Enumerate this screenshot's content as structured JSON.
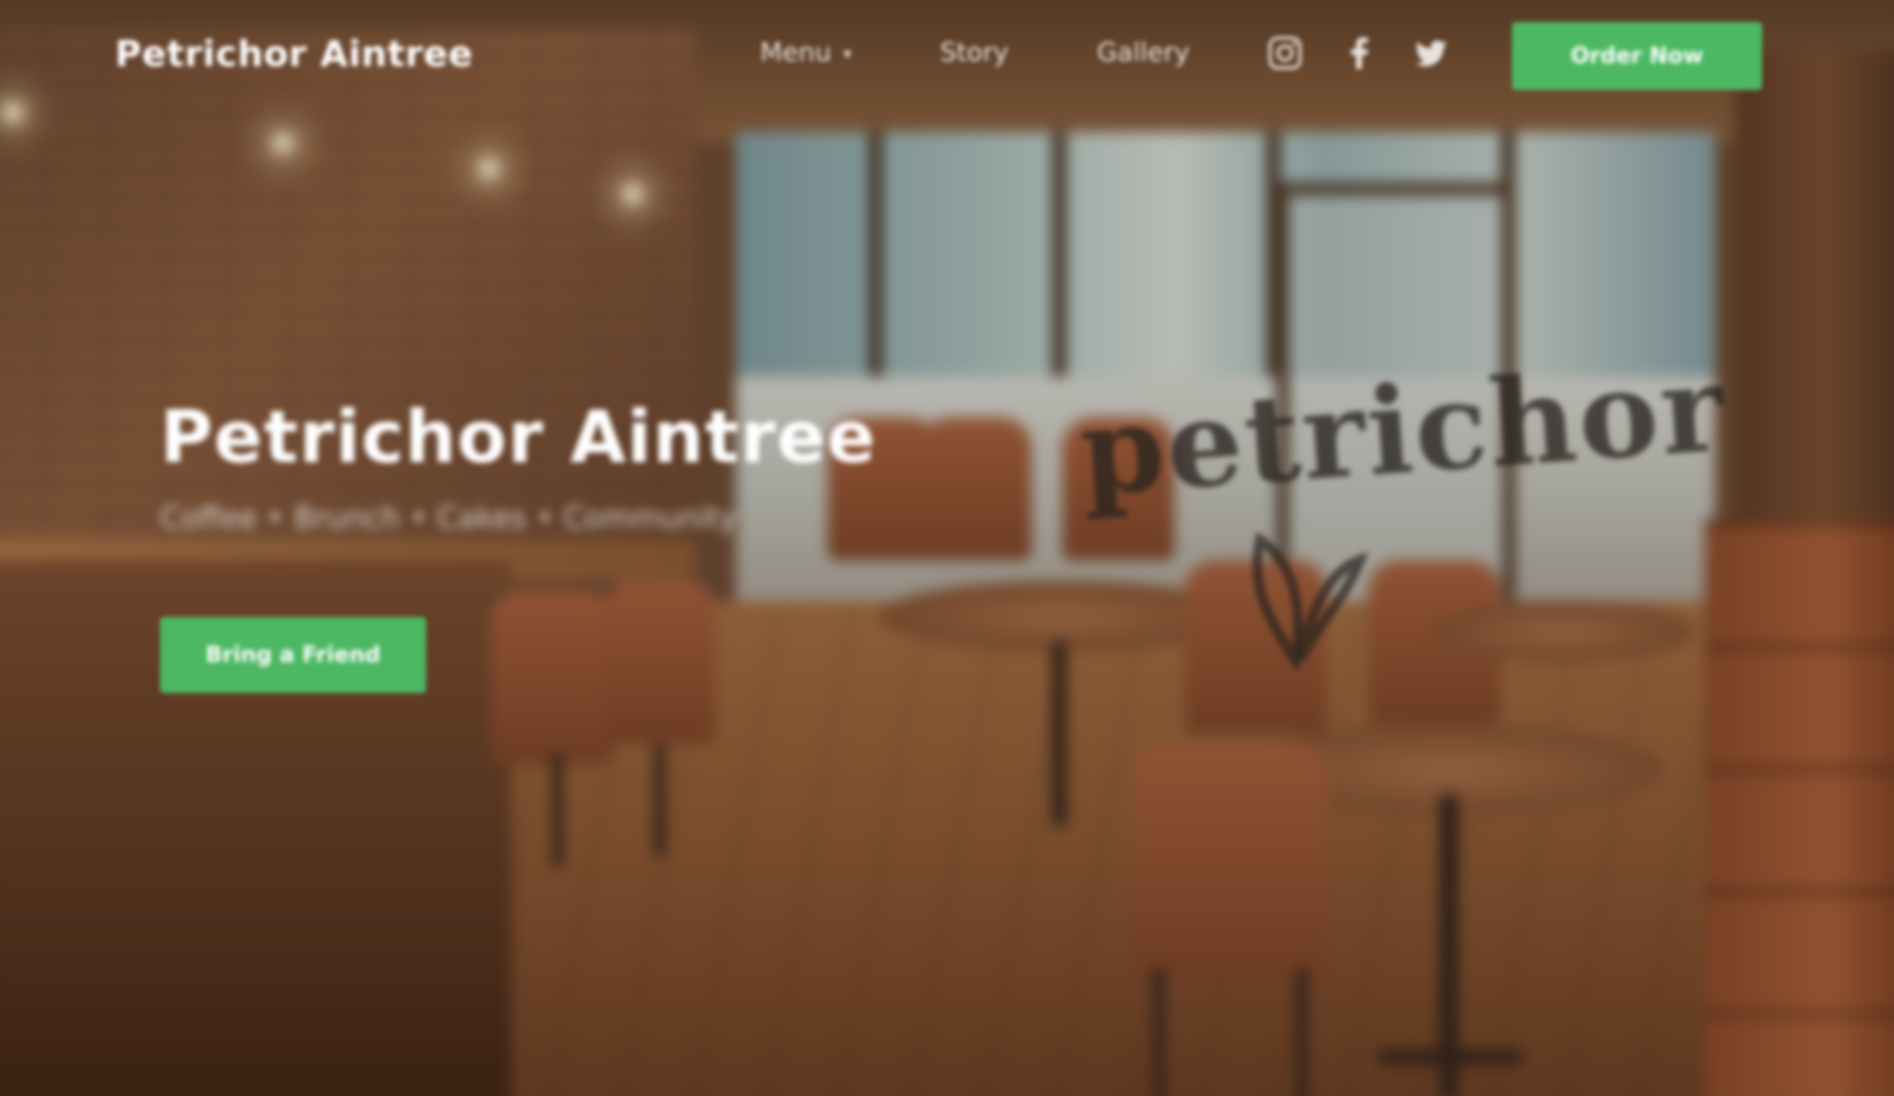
{
  "brand": {
    "name": "Petrichor Aintree"
  },
  "nav": {
    "links": [
      {
        "label": "Menu",
        "has_dropdown": true
      },
      {
        "label": "Story",
        "has_dropdown": false
      },
      {
        "label": "Gallery",
        "has_dropdown": false
      }
    ],
    "social": [
      {
        "icon": "instagram-icon"
      },
      {
        "icon": "facebook-icon"
      },
      {
        "icon": "twitter-icon"
      }
    ],
    "cta_label": "Order Now"
  },
  "hero": {
    "title": "Petrichor Aintree",
    "subtitle": "Coffee • Brunch • Cakes • Community",
    "cta_label": "Bring a Friend",
    "window_decal_text": "petrichor"
  },
  "colors": {
    "accent_green": "#4cb863",
    "text_white": "#ffffff"
  }
}
